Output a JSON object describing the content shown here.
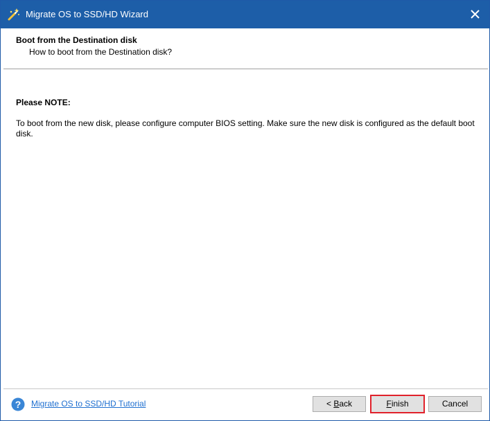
{
  "window": {
    "title": "Migrate OS to SSD/HD Wizard",
    "icon": "wizard-app-icon",
    "close_icon": "close-icon"
  },
  "header": {
    "title": "Boot from the Destination disk",
    "subtitle": "How to boot from the Destination disk?"
  },
  "content": {
    "note_title": "Please NOTE:",
    "note_body": "To boot from the new disk, please configure computer BIOS setting. Make sure the new disk is configured as the default boot disk."
  },
  "footer": {
    "help_icon": "help-icon",
    "tutorial_link": "Migrate OS to SSD/HD Tutorial",
    "buttons": {
      "back_prefix": "< ",
      "back_mnemonic": "B",
      "back_rest": "ack",
      "finish_mnemonic": "F",
      "finish_rest": "inish",
      "cancel": "Cancel"
    }
  },
  "colors": {
    "titlebar": "#1d5ea8",
    "link": "#1e6fd0",
    "highlight_border": "#e0202a",
    "help_icon": "#3a86d6"
  }
}
